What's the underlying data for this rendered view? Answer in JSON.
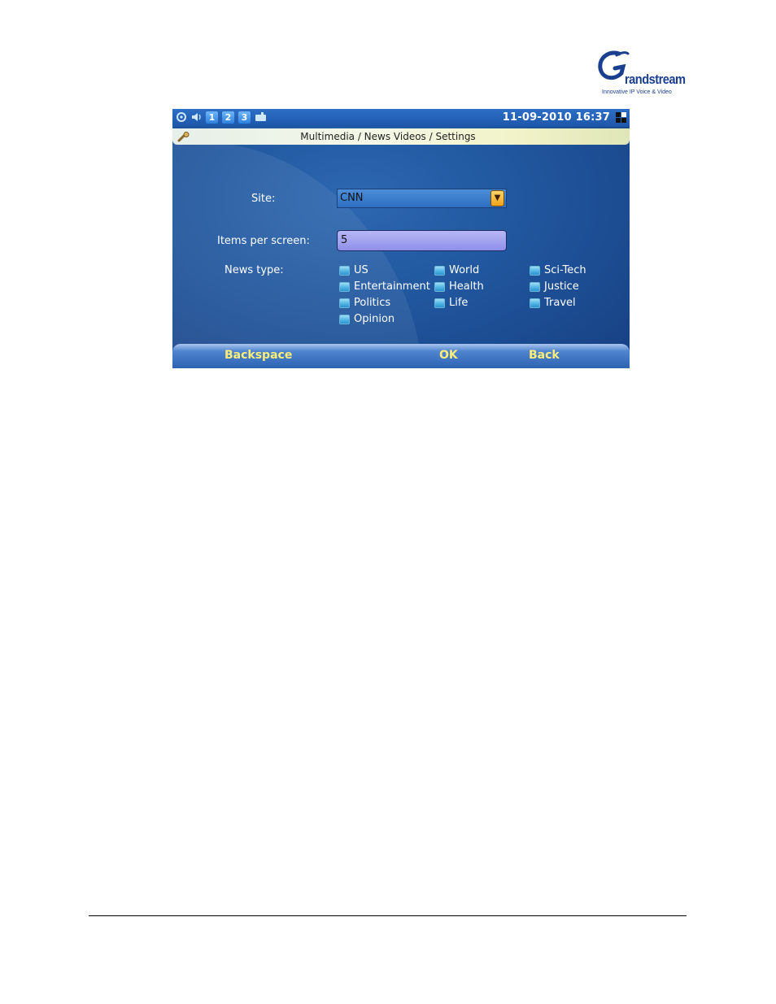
{
  "logo": {
    "brand": "Grandstream",
    "wordmark": "randstream",
    "tagline": "Innovative IP Voice & Video",
    "color": "#1b3f8f"
  },
  "statusbar": {
    "icons": [
      "network-icon",
      "volume-icon",
      "line-1",
      "line-2",
      "line-3",
      "message-icon"
    ],
    "lines": [
      "1",
      "2",
      "3"
    ],
    "datetime": "11-09-2010 16:37"
  },
  "titlebar": {
    "title": "Multimedia / News Videos / Settings"
  },
  "form": {
    "site_label": "Site:",
    "site_value": "CNN",
    "items_label": "Items per screen:",
    "items_value": "5",
    "news_type_label": "News type:",
    "news_types": [
      "US",
      "World",
      "Sci-Tech",
      "Entertainment",
      "Health",
      "Justice",
      "Politics",
      "Life",
      "Travel",
      "Opinion"
    ]
  },
  "softkeys": {
    "left": "Backspace",
    "middle": "OK",
    "right": "Back"
  },
  "colors": {
    "softkey_text": "#ffee77",
    "screen_background": "#2158a0"
  }
}
